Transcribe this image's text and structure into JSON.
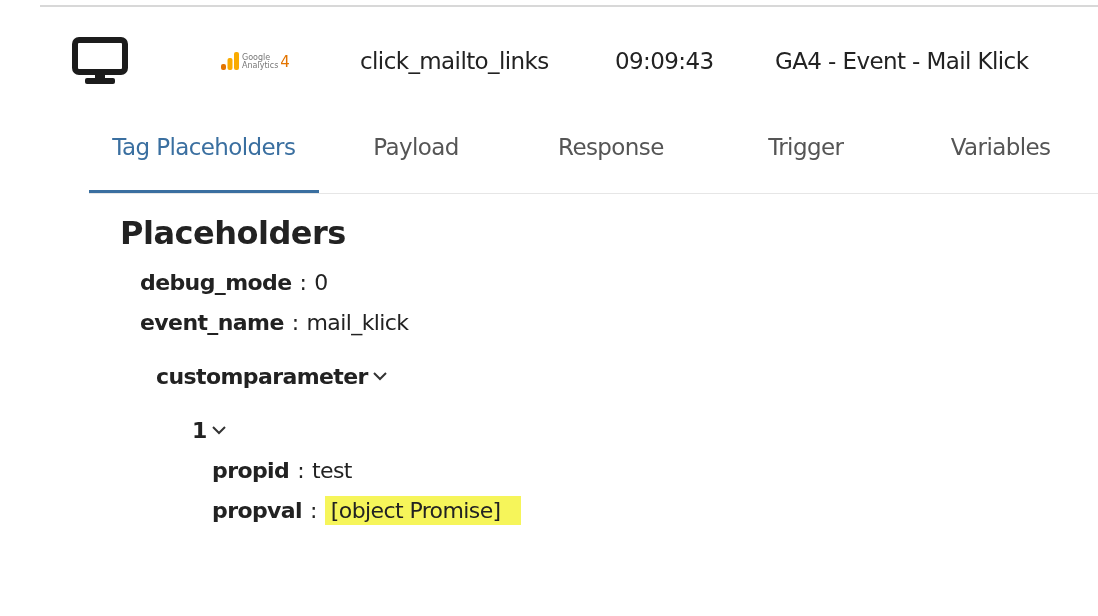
{
  "event": {
    "logo": {
      "line1": "Google",
      "line2": "Analytics",
      "version": "4"
    },
    "name": "click_mailto_links",
    "time": "09:09:43",
    "tag": "GA4 - Event - Mail Klick"
  },
  "tabs": [
    {
      "label": "Tag Placeholders",
      "selected": true
    },
    {
      "label": "Payload",
      "selected": false
    },
    {
      "label": "Response",
      "selected": false
    },
    {
      "label": "Trigger",
      "selected": false
    },
    {
      "label": "Variables",
      "selected": false
    }
  ],
  "placeholders": {
    "title": "Placeholders",
    "items": [
      {
        "key": "debug_mode",
        "separator": ":",
        "value": "0",
        "highlighted": false
      },
      {
        "key": "event_name",
        "separator": ":",
        "value": "mail_klick",
        "highlighted": false
      },
      {
        "key": "customparameter",
        "expanded": true,
        "children": [
          {
            "key": "1",
            "expanded": true,
            "children": [
              {
                "key": "propid",
                "separator": ":",
                "value": "test",
                "highlighted": false
              },
              {
                "key": "propval",
                "separator": ":",
                "value": "[object Promise]",
                "highlighted": true
              }
            ]
          }
        ]
      }
    ]
  }
}
